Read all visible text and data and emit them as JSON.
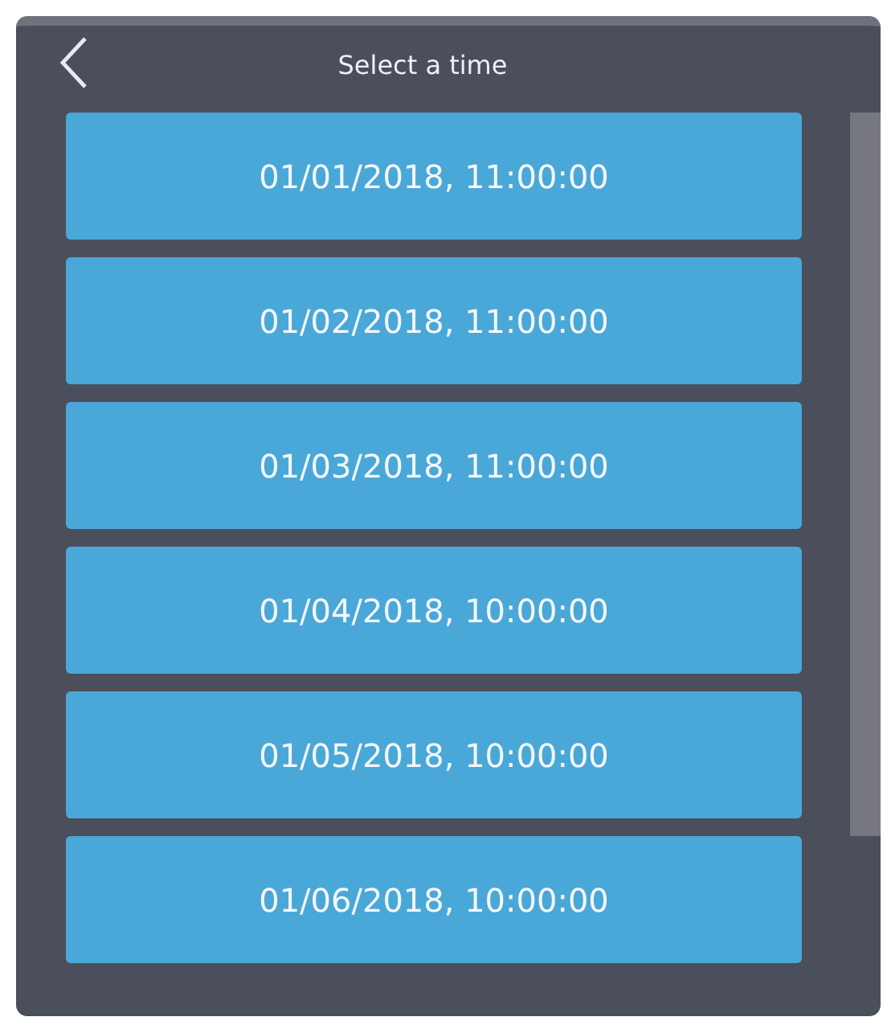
{
  "header": {
    "title": "Select a time"
  },
  "times": [
    {
      "label": "01/01/2018, 11:00:00"
    },
    {
      "label": "01/02/2018, 11:00:00"
    },
    {
      "label": "01/03/2018, 11:00:00"
    },
    {
      "label": "01/04/2018, 10:00:00"
    },
    {
      "label": "01/05/2018, 10:00:00"
    },
    {
      "label": "01/06/2018, 10:00:00"
    }
  ]
}
